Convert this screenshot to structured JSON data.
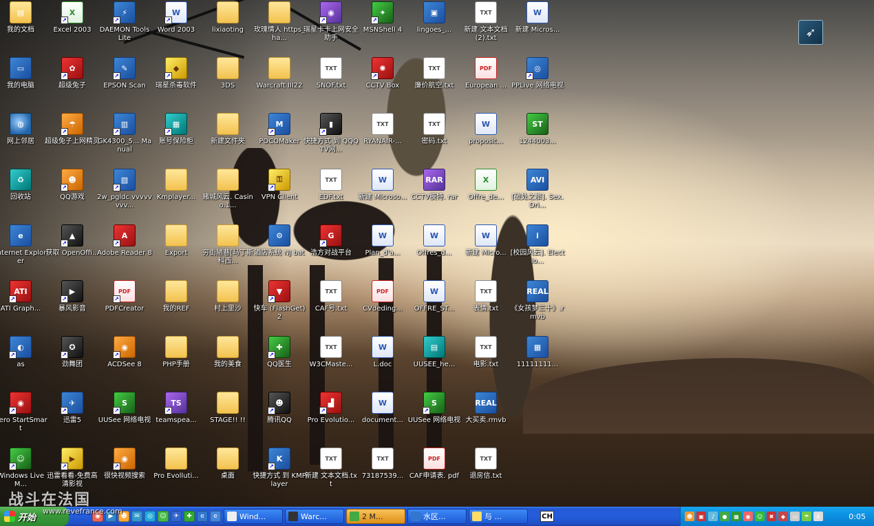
{
  "desktop": {
    "icons": [
      {
        "label": "我的文档",
        "glyph": "▤",
        "kind": "folder",
        "shortcut": false
      },
      {
        "label": "Excel 2003",
        "glyph": "X",
        "kind": "excel",
        "shortcut": true
      },
      {
        "label": "DAEMON Tools Lite",
        "glyph": "⚡",
        "kind": "app",
        "shortcut": true
      },
      {
        "label": "Word 2003",
        "glyph": "W",
        "kind": "word",
        "shortcut": true
      },
      {
        "label": "lixiaoting",
        "glyph": "",
        "kind": "folder",
        "shortcut": false
      },
      {
        "label": "玫瑰情人 https_ha...",
        "glyph": "",
        "kind": "folder",
        "shortcut": false
      },
      {
        "label": "瑞星卡卡上网安全助手",
        "glyph": "◉",
        "kind": "purple",
        "shortcut": true
      },
      {
        "label": "MSNShell 4",
        "glyph": "✦",
        "kind": "green",
        "shortcut": true
      },
      {
        "label": "lingoes_...",
        "glyph": "▣",
        "kind": "app",
        "shortcut": false
      },
      {
        "label": "新建 文本文档 (2).txt",
        "glyph": "TXT",
        "kind": "txt",
        "shortcut": false
      },
      {
        "label": "新建 Micros...",
        "glyph": "W",
        "kind": "word",
        "shortcut": false
      },
      {
        "label": "我的电脑",
        "glyph": "▭",
        "kind": "app",
        "shortcut": false
      },
      {
        "label": "超级兔子",
        "glyph": "✿",
        "kind": "red",
        "shortcut": true
      },
      {
        "label": "EPSON Scan",
        "glyph": "✎",
        "kind": "app",
        "shortcut": true
      },
      {
        "label": "瑞星杀毒软件",
        "glyph": "◆",
        "kind": "yellow",
        "shortcut": true
      },
      {
        "label": "3DS",
        "glyph": "",
        "kind": "folder",
        "shortcut": false
      },
      {
        "label": "Warcraft III22",
        "glyph": "",
        "kind": "folder",
        "shortcut": false
      },
      {
        "label": "SNOF.txt",
        "glyph": "TXT",
        "kind": "txt",
        "shortcut": false
      },
      {
        "label": "CCTV Box",
        "glyph": "✺",
        "kind": "red",
        "shortcut": true
      },
      {
        "label": "廉价航空.txt",
        "glyph": "TXT",
        "kind": "txt",
        "shortcut": false
      },
      {
        "label": "European ...",
        "glyph": "PDF",
        "kind": "pdf",
        "shortcut": false
      },
      {
        "label": "PPLive 网络电视",
        "glyph": "◎",
        "kind": "app",
        "shortcut": true
      },
      {
        "label": "网上邻居",
        "glyph": "◍",
        "kind": "globe",
        "shortcut": false
      },
      {
        "label": "超级兔子上网精灵",
        "glyph": "☂",
        "kind": "orange",
        "shortcut": true
      },
      {
        "label": "GK4300_5... Manual",
        "glyph": "▥",
        "kind": "app",
        "shortcut": true
      },
      {
        "label": "账号保险柜",
        "glyph": "▦",
        "kind": "teal",
        "shortcut": true
      },
      {
        "label": "新建文件夹",
        "glyph": "",
        "kind": "folder",
        "shortcut": false
      },
      {
        "label": "POCOMaker",
        "glyph": "M",
        "kind": "app",
        "shortcut": true
      },
      {
        "label": "快捷方式 到 QQQTV网...",
        "glyph": "▮",
        "kind": "dark",
        "shortcut": true
      },
      {
        "label": "RYANAIR-...",
        "glyph": "TXT",
        "kind": "txt",
        "shortcut": false
      },
      {
        "label": "密码.txt",
        "glyph": "TXT",
        "kind": "txt",
        "shortcut": false
      },
      {
        "label": "proposit...",
        "glyph": "W",
        "kind": "word",
        "shortcut": false
      },
      {
        "label": "1244003...",
        "glyph": "ST",
        "kind": "green",
        "shortcut": false
      },
      {
        "label": "回收站",
        "glyph": "♻",
        "kind": "teal",
        "shortcut": false
      },
      {
        "label": "QQ游戏",
        "glyph": "☻",
        "kind": "orange",
        "shortcut": true
      },
      {
        "label": "2w_pgldc vvvvvvvv...",
        "glyph": "▧",
        "kind": "app",
        "shortcut": true
      },
      {
        "label": "Kmplayer...",
        "glyph": "",
        "kind": "folder",
        "shortcut": false
      },
      {
        "label": "赌城风云. Casino.1...",
        "glyph": "",
        "kind": "folder",
        "shortcut": false
      },
      {
        "label": "VPN Client",
        "glyph": "⚿",
        "kind": "yellow",
        "shortcut": true
      },
      {
        "label": "EDF.txt",
        "glyph": "TXT",
        "kind": "txt",
        "shortcut": false
      },
      {
        "label": "新建 Microso...",
        "glyph": "W",
        "kind": "word",
        "shortcut": false
      },
      {
        "label": "CCTV模特. rar",
        "glyph": "RAR",
        "kind": "purple",
        "shortcut": false
      },
      {
        "label": "Offre_de...",
        "glyph": "X",
        "kind": "excel",
        "shortcut": false
      },
      {
        "label": "[破处之旅]. Sex.Dri...",
        "glyph": "AVI",
        "kind": "app",
        "shortcut": false
      },
      {
        "label": "Internet Explorer",
        "glyph": "e",
        "kind": "app",
        "shortcut": false
      },
      {
        "label": "获取 OpenOffi...",
        "glyph": "▲",
        "kind": "dark",
        "shortcut": true
      },
      {
        "label": "Adobe Reader 8",
        "glyph": "A",
        "kind": "red",
        "shortcut": true
      },
      {
        "label": "Export",
        "glyph": "",
        "kind": "folder",
        "shortcut": false
      },
      {
        "label": "穷街陋巷[马丁斯科西...",
        "glyph": "",
        "kind": "folder",
        "shortcut": false
      },
      {
        "label": "酒店系统 NJ bat",
        "glyph": "⚙",
        "kind": "app",
        "shortcut": false
      },
      {
        "label": "浩方对战平台",
        "glyph": "G",
        "kind": "red",
        "shortcut": true
      },
      {
        "label": "Plan_d'a...",
        "glyph": "W",
        "kind": "word",
        "shortcut": false
      },
      {
        "label": "Offres_d...",
        "glyph": "W",
        "kind": "word",
        "shortcut": false
      },
      {
        "label": "新建 Micro...",
        "glyph": "W",
        "kind": "word",
        "shortcut": false
      },
      {
        "label": "[校园风云]. Electio...",
        "glyph": "i",
        "kind": "app",
        "shortcut": false
      },
      {
        "label": "ATI Graph...",
        "glyph": "ATI",
        "kind": "red",
        "shortcut": true
      },
      {
        "label": "暴风影音",
        "glyph": "▶",
        "kind": "dark",
        "shortcut": true
      },
      {
        "label": "PDFCreator",
        "glyph": "PDF",
        "kind": "pdf",
        "shortcut": true
      },
      {
        "label": "我的REF",
        "glyph": "",
        "kind": "folder",
        "shortcut": false
      },
      {
        "label": "村上里沙",
        "glyph": "",
        "kind": "folder",
        "shortcut": false
      },
      {
        "label": "快车 (FlashGet)2",
        "glyph": "▼",
        "kind": "red",
        "shortcut": true
      },
      {
        "label": "CAF号.txt",
        "glyph": "TXT",
        "kind": "txt",
        "shortcut": false
      },
      {
        "label": "CVdeding...",
        "glyph": "PDF",
        "kind": "pdf",
        "shortcut": false
      },
      {
        "label": "OFFRE_ST...",
        "glyph": "W",
        "kind": "word",
        "shortcut": false
      },
      {
        "label": "表情.txt",
        "glyph": "TXT",
        "kind": "txt",
        "shortcut": false
      },
      {
        "label": "《女孩梦三十》.rmvb",
        "glyph": "REAL",
        "kind": "app",
        "shortcut": false
      },
      {
        "label": "as",
        "glyph": "◐",
        "kind": "app",
        "shortcut": true
      },
      {
        "label": "劲舞团",
        "glyph": "✪",
        "kind": "dark",
        "shortcut": true
      },
      {
        "label": "ACDSee 8",
        "glyph": "◉",
        "kind": "orange",
        "shortcut": true
      },
      {
        "label": "PHP手册",
        "glyph": "",
        "kind": "folder",
        "shortcut": false
      },
      {
        "label": "我的美食",
        "glyph": "",
        "kind": "folder",
        "shortcut": false
      },
      {
        "label": "QQ医生",
        "glyph": "✚",
        "kind": "green",
        "shortcut": true
      },
      {
        "label": "W3CMaste...",
        "glyph": "TXT",
        "kind": "txt",
        "shortcut": false
      },
      {
        "label": "L.doc",
        "glyph": "W",
        "kind": "word",
        "shortcut": false
      },
      {
        "label": "UUSEE_he...",
        "glyph": "▤",
        "kind": "teal",
        "shortcut": false
      },
      {
        "label": "电影.txt",
        "glyph": "TXT",
        "kind": "txt",
        "shortcut": false
      },
      {
        "label": "11111111...",
        "glyph": "▦",
        "kind": "app",
        "shortcut": false
      },
      {
        "label": "Nero StartSmart",
        "glyph": "◉",
        "kind": "red",
        "shortcut": true
      },
      {
        "label": "迅雷5",
        "glyph": "✈",
        "kind": "app",
        "shortcut": true
      },
      {
        "label": "UUSee 网络电视",
        "glyph": "S",
        "kind": "green",
        "shortcut": true
      },
      {
        "label": "teamspea...",
        "glyph": "TS",
        "kind": "purple",
        "shortcut": true
      },
      {
        "label": "STAGE!! !!",
        "glyph": "",
        "kind": "folder",
        "shortcut": false
      },
      {
        "label": "腾讯QQ",
        "glyph": "☻",
        "kind": "dark",
        "shortcut": true
      },
      {
        "label": "Pro Evolutio...",
        "glyph": "▟",
        "kind": "red",
        "shortcut": true
      },
      {
        "label": "document...",
        "glyph": "W",
        "kind": "word",
        "shortcut": false
      },
      {
        "label": "UUSee 网络电视",
        "glyph": "S",
        "kind": "green",
        "shortcut": true
      },
      {
        "label": "大买卖.rmvb",
        "glyph": "REAL",
        "kind": "app",
        "shortcut": false
      },
      {
        "label": "",
        "glyph": "",
        "kind": "none",
        "shortcut": false
      },
      {
        "label": "Windows Live M...",
        "glyph": "☺",
        "kind": "green",
        "shortcut": true
      },
      {
        "label": "迅雷看看-免费高清影视",
        "glyph": "▶",
        "kind": "yellow",
        "shortcut": true
      },
      {
        "label": "很快视频搜索",
        "glyph": "◉",
        "kind": "orange",
        "shortcut": true
      },
      {
        "label": "Pro Evolluti...",
        "glyph": "",
        "kind": "folder",
        "shortcut": false
      },
      {
        "label": "桌面",
        "glyph": "",
        "kind": "folder",
        "shortcut": false
      },
      {
        "label": "快捷方式 到 KMPlayer",
        "glyph": "K",
        "kind": "app",
        "shortcut": true
      },
      {
        "label": "新建 文本文档.txt",
        "glyph": "TXT",
        "kind": "txt",
        "shortcut": false
      },
      {
        "label": "73187539...",
        "glyph": "TXT",
        "kind": "txt",
        "shortcut": false
      },
      {
        "label": "CAF申请表. pdf",
        "glyph": "PDF",
        "kind": "pdf",
        "shortcut": false
      },
      {
        "label": "退房信.txt",
        "glyph": "TXT",
        "kind": "txt",
        "shortcut": false
      }
    ],
    "corner_glyph": "➶",
    "watermark": "战斗在法国",
    "watermark_url": "www.revefrance.com"
  },
  "taskbar": {
    "start_label": "开始",
    "quick_launch": [
      {
        "glyph": "◉",
        "color": "#e65"
      },
      {
        "glyph": "▶",
        "color": "#38c"
      },
      {
        "glyph": "☻",
        "color": "#fa3"
      },
      {
        "glyph": "✉",
        "color": "#39c"
      },
      {
        "glyph": "◎",
        "color": "#2ad"
      },
      {
        "glyph": "☺",
        "color": "#4b4"
      },
      {
        "glyph": "✈",
        "color": "#36c"
      },
      {
        "glyph": "✚",
        "color": "#3a3"
      },
      {
        "glyph": "e",
        "color": "#37c"
      },
      {
        "glyph": "e",
        "color": "#48d"
      }
    ],
    "tasks": [
      {
        "label": "Wind...",
        "color": "#eee",
        "active": false
      },
      {
        "label": "Warc...",
        "color": "#333",
        "active": false
      },
      {
        "label": "2 M...",
        "color": "#4a4",
        "active": true
      },
      {
        "label": "水区...",
        "color": "#37c",
        "active": false
      },
      {
        "label": "与 ...",
        "color": "#fd6",
        "active": false
      }
    ],
    "language": "CH",
    "tray_icons": [
      {
        "glyph": "☻",
        "color": "#e93"
      },
      {
        "glyph": "▣",
        "color": "#c33"
      },
      {
        "glyph": "♪",
        "color": "#6bd"
      },
      {
        "glyph": "●",
        "color": "#4a4"
      },
      {
        "glyph": "▦",
        "color": "#393"
      },
      {
        "glyph": "◉",
        "color": "#e66"
      },
      {
        "glyph": "☺",
        "color": "#3b3"
      },
      {
        "glyph": "✖",
        "color": "#c33"
      },
      {
        "glyph": "◆",
        "color": "#c44"
      },
      {
        "glyph": "▭",
        "color": "#ccc"
      },
      {
        "glyph": "☂",
        "color": "#7c4"
      },
      {
        "glyph": "A",
        "color": "#ddd"
      }
    ],
    "clock": "0:05"
  }
}
